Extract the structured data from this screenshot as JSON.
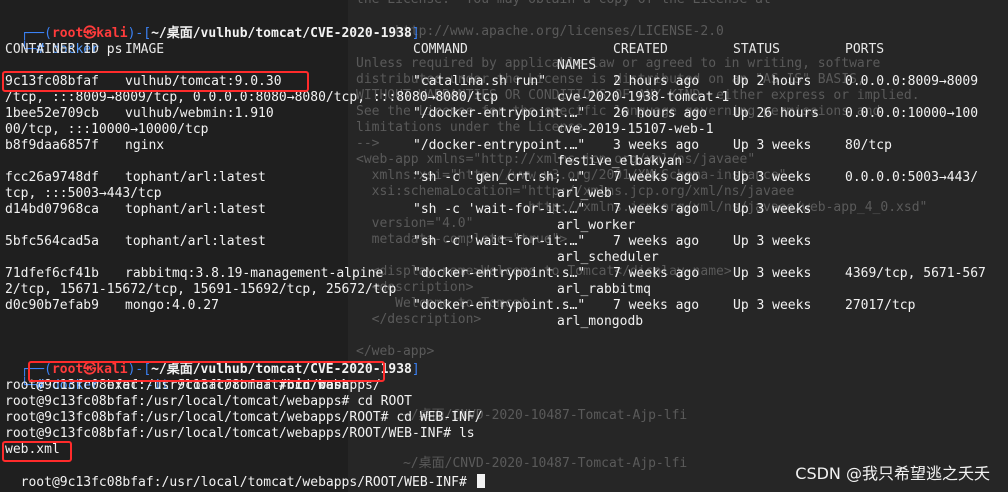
{
  "background_ghost": [
    "the License.  You may obtain a copy of the License at",
    "",
    "     http://www.apache.org/licenses/LICENSE-2.0",
    "",
    "Unless required by applicable law or agreed to in writing, software",
    "distributed under the License is distributed on an \"AS IS\" BASIS,",
    "WITHOUT WARRANTIES OR CONDITIONS OF ANY KIND, either express or implied.",
    "See the License for the specific language governing permissions and",
    "limitations under the License.",
    "-->",
    "<web-app xmlns=\"http://xmlns.jcp.org/xml/ns/javaee\"",
    "  xmlns:xsi=\"http://www.w3.org/2001/XMLSchema-instance\"",
    "  xsi:schemaLocation=\"http://xmlns.jcp.org/xml/ns/javaee",
    "                      http://xmlns.jcp.org/xml/ns/javaee/web-app_4_0.xsd\"",
    "  version=\"4.0\"",
    "  metadata-complete=\"true\">",
    "",
    "  <display-name>Welcome to Tomcat</display-name>",
    "  <description>",
    "     Welcome to Tomcat",
    "  </description>",
    "",
    "</web-app>",
    "",
    "",
    "",
    "      ~/桌面/CNVD-2020-10487-Tomcat-Ajp-lfi",
    "",
    "",
    "      ~/桌面/CNVD-2020-10487-Tomcat-Ajp-lfi"
  ],
  "prompt1": {
    "open": "┌──(",
    "user": "root㉿kali",
    "mid": ")-[",
    "path": "~/桌面/vulhub/tomcat/CVE-2020-1938",
    "close": "]",
    "hash_prefix": "└─",
    "hash": "#",
    "command": "docker",
    "args": " ps"
  },
  "docker_ps": {
    "headers": {
      "container_id": "CONTAINER ID",
      "image": "IMAGE",
      "command": "COMMAND",
      "created": "CREATED",
      "status": "STATUS",
      "ports": "PORTS",
      "names": "NAMES"
    },
    "rows": [
      {
        "id": "9c13fc08bfaf",
        "image": "vulhub/tomcat:9.0.30",
        "command": "\"catalina.sh run\"",
        "created": "2 hours ago",
        "status": "Up 2 hours",
        "ports": "0.0.0.0:8009→8009",
        "wrap": "/tcp, :::8009→8009/tcp, 0.0.0.0:8080→8080/tcp, :::8080→8080/tcp",
        "name": "cve-2020-1938-tomcat-1"
      },
      {
        "id": "1bee52e709cb",
        "image": "vulhub/webmin:1.910",
        "command": "\"/docker-entrypoint.…\"",
        "created": "26 hours ago",
        "status": "Up 26 hours",
        "ports": "0.0.0.0:10000→100",
        "wrap": "00/tcp, :::10000→10000/tcp",
        "name": "cve-2019-15107-web-1"
      },
      {
        "id": "b8f9daa6857f",
        "image": "nginx",
        "command": "\"/docker-entrypoint.…\"",
        "created": "3 weeks ago",
        "status": "Up 3 weeks",
        "ports": "80/tcp",
        "wrap": "",
        "name": "festive_elbakyan"
      },
      {
        "id": "fcc26a9748df",
        "image": "tophant/arl:latest",
        "command": "\"sh -c 'gen_crt.sh; …\"",
        "created": "7 weeks ago",
        "status": "Up 3 weeks",
        "ports": "0.0.0.0:5003→443/",
        "wrap": "tcp, :::5003→443/tcp",
        "name": "arl_web"
      },
      {
        "id": "d14bd07968ca",
        "image": "tophant/arl:latest",
        "command": "\"sh -c 'wait-for-it.…\"",
        "created": "7 weeks ago",
        "status": "Up 3 weeks",
        "ports": "",
        "wrap": "",
        "name": "arl_worker"
      },
      {
        "id": "5bfc564cad5a",
        "image": "tophant/arl:latest",
        "command": "\"sh -c 'wait-for-it.…\"",
        "created": "7 weeks ago",
        "status": "Up 3 weeks",
        "ports": "",
        "wrap": "",
        "name": "arl_scheduler"
      },
      {
        "id": "71dfef6cf41b",
        "image": "rabbitmq:3.8.19-management-alpine",
        "command": "\"docker-entrypoint.s…\"",
        "created": "7 weeks ago",
        "status": "Up 3 weeks",
        "ports": "4369/tcp, 5671-567",
        "wrap": "2/tcp, 15671-15672/tcp, 15691-15692/tcp, 25672/tcp",
        "name": "arl_rabbitmq"
      },
      {
        "id": "d0c90b7efab9",
        "image": "mongo:4.0.27",
        "command": "\"docker-entrypoint.s…\"",
        "created": "7 weeks ago",
        "status": "Up 3 weeks",
        "ports": "27017/tcp",
        "wrap": "",
        "name": "arl_mongodb"
      }
    ]
  },
  "prompt2": {
    "open": "┌──(",
    "user": "root㉿kali",
    "mid": ")-[",
    "path": "~/桌面/vulhub/tomcat/CVE-2020-1938",
    "close": "]",
    "hash_prefix": "└─",
    "hash": "#",
    "command": "docker",
    "args_a": " exec ",
    "flag": "-it",
    "args_b": " 9c13fc08bfaf ",
    "shell": "/bin/bash"
  },
  "shell_lines": [
    "root@9c13fc08bfaf:/usr/local/tomcat# cd webapps/",
    "root@9c13fc08bfaf:/usr/local/tomcat/webapps# cd ROOT",
    "root@9c13fc08bfaf:/usr/local/tomcat/webapps/ROOT# cd WEB-INF/",
    "root@9c13fc08bfaf:/usr/local/tomcat/webapps/ROOT/WEB-INF# ls"
  ],
  "ls_output": "web.xml",
  "last_prompt": "root@9c13fc08bfaf:/usr/local/tomcat/webapps/ROOT/WEB-INF# ",
  "watermark": "CSDN @我只希望逃之夭夭",
  "colors": {
    "prompt_frame": "#3b82f6",
    "user": "#ff3b3b",
    "highlight_box": "#ff2b2b",
    "text": "#e8e8e8"
  }
}
